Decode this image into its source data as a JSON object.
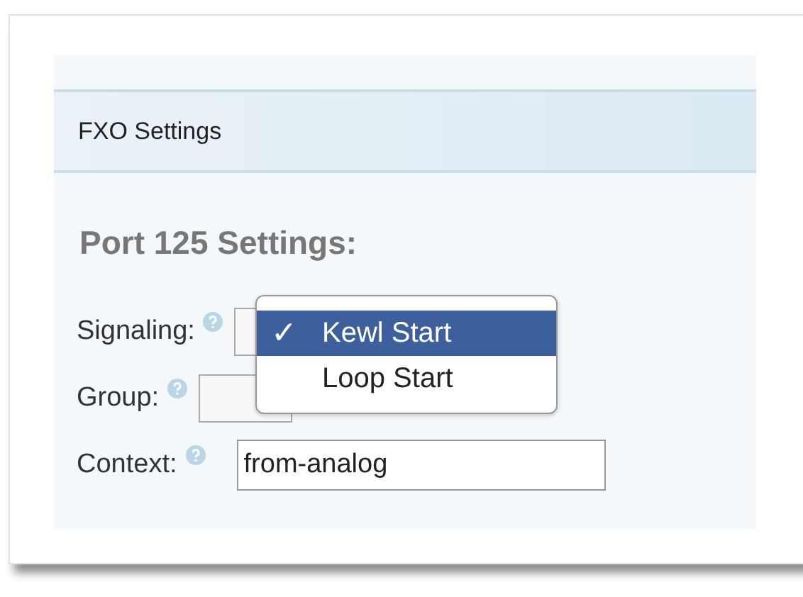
{
  "section": {
    "title": "FXO Settings"
  },
  "heading": "Port 125 Settings:",
  "fields": [
    {
      "kind": "select",
      "label": "Signaling:"
    },
    {
      "kind": "select",
      "label": "Group:"
    },
    {
      "kind": "text",
      "label": "Context:",
      "value": "from-analog"
    }
  ],
  "dropdown": {
    "check_mark": "✓",
    "options": [
      {
        "label": "Kewl Start",
        "selected": true
      },
      {
        "label": "Loop Start",
        "selected": false
      }
    ]
  }
}
